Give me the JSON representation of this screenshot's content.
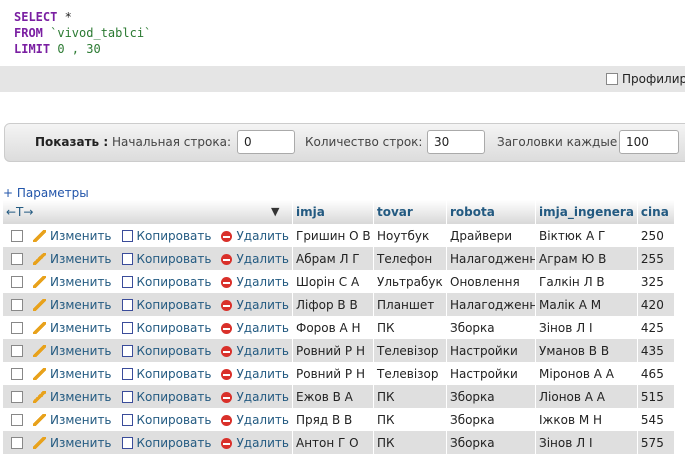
{
  "sql": {
    "line1_kw": "SELECT",
    "line1_rest": " *",
    "line2_kw": "FROM",
    "line2_rest": " `vivod_tablci`",
    "line3_kw": "LIMIT",
    "line3_rest": " 0 , 30",
    "profiling_label": "Профилир"
  },
  "nav": {
    "show_label": "Показать :",
    "start_label": "Начальная строка:",
    "start_value": "0",
    "count_label": "Количество строк:",
    "count_value": "30",
    "headers_label": "Заголовки каждые",
    "headers_value": "100"
  },
  "params_label": "+ Параметры",
  "table": {
    "arrows": "←T→",
    "sort_icon": "▼",
    "columns": [
      "imja",
      "tovar",
      "robota",
      "imja_ingenera",
      "cina"
    ],
    "action_labels": {
      "edit": "Изменить",
      "copy": "Копировать",
      "delete": "Удалить"
    },
    "rows": [
      [
        "Гришин О В",
        "Ноутбук",
        "Драйвери",
        "Віктюк А Г",
        "250"
      ],
      [
        "Абрам Л Г",
        "Телефон",
        "Налагодженн",
        "Аграм Ю В",
        "255"
      ],
      [
        "Шорін С А",
        "Ультрабук",
        "Оновлення",
        "Галкін Л В",
        "325"
      ],
      [
        "Ліфор В В",
        "Планшет",
        "Налагодженн",
        "Малік А М",
        "420"
      ],
      [
        "Форов А Н",
        "ПК",
        "Зборка",
        "Зінов Л І",
        "425"
      ],
      [
        "Ровний Р Н",
        "Телевізор",
        "Настройки",
        "Уманов В В",
        "435"
      ],
      [
        "Ровний Р Н",
        "Телевізор",
        "Настройки",
        "Міронов А А",
        "465"
      ],
      [
        "Ежов В А",
        "ПК",
        "Зборка",
        "Ліонов А А",
        "515"
      ],
      [
        "Пряд В В",
        "ПК",
        "Зборка",
        "Іжков М Н",
        "545"
      ],
      [
        "Антон Г О",
        "ПК",
        "Зборка",
        "Зінов Л І",
        "575"
      ]
    ]
  }
}
